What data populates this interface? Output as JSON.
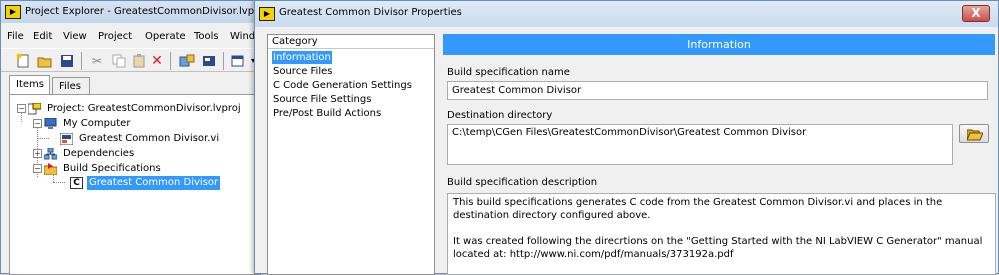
{
  "project_explorer": {
    "title": "Project Explorer - GreatestCommonDivisor.lvproj",
    "app_icon": "labview-icon",
    "menu": [
      "File",
      "Edit",
      "View",
      "Project",
      "Operate",
      "Tools",
      "Wind"
    ],
    "toolbar_icons": [
      "new-icon",
      "open-icon",
      "save-all-icon",
      "cut-icon",
      "copy-icon",
      "paste-icon",
      "delete-icon",
      "build-icon",
      "deploy-icon",
      "window-icon"
    ],
    "tabs": [
      "Items",
      "Files"
    ],
    "tree": [
      {
        "label": "Project: GreatestCommonDivisor.lvproj",
        "icon": "project-icon"
      },
      {
        "label": "My Computer",
        "icon": "computer-icon"
      },
      {
        "label": "Greatest Common Divisor.vi",
        "icon": "vi-icon"
      },
      {
        "label": "Dependencies",
        "icon": "dependencies-icon"
      },
      {
        "label": "Build Specifications",
        "icon": "build-specs-icon"
      },
      {
        "label": "Greatest Common Divisor",
        "icon": "c-build-icon",
        "selected": true
      }
    ],
    "c_icon_letter": "C",
    "selection_color": "#3399ff"
  },
  "dialog": {
    "title": "Greatest Common Divisor Properties",
    "close_symbol": "X",
    "category_header": "Category",
    "categories": [
      "Information",
      "Source Files",
      "C Code Generation Settings",
      "Source File Settings",
      "Pre/Post Build Actions"
    ],
    "selected_category": "Information",
    "section_title": "Information",
    "accent_color": "#3399ff",
    "build_name_label": "Build specification name",
    "build_name_value": "Greatest Common Divisor",
    "destination_label": "Destination directory",
    "destination_value": "C:\\temp\\CGen Files\\GreatestCommonDivisor\\Greatest Common Divisor",
    "browse_icon": "folder-open-icon",
    "description_label": "Build specification description",
    "description_line1": "This build specifications generates C code from the Greatest Common Divisor.vi and places in the destination directory configured above.",
    "description_line2": "It was created following the direcrtions on the \"Getting Started with the NI LabVIEW C Generator\" manual located at: http://www.ni.com/pdf/manuals/373192a.pdf"
  }
}
